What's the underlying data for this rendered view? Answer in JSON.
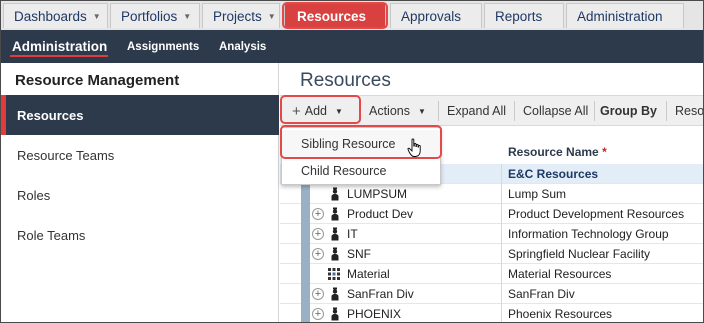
{
  "top_tabs": [
    {
      "label": "Dashboards",
      "has_caret": true
    },
    {
      "label": "Portfolios",
      "has_caret": true
    },
    {
      "label": "Projects",
      "has_caret": true
    },
    {
      "label": "Resources",
      "has_caret": false,
      "active": true
    },
    {
      "label": "Approvals",
      "has_caret": false
    },
    {
      "label": "Reports",
      "has_caret": false
    },
    {
      "label": "Administration",
      "has_caret": false
    }
  ],
  "sub_nav": {
    "administration": "Administration",
    "assignments": "Assignments",
    "analysis": "Analysis"
  },
  "sidebar": {
    "title": "Resource Management",
    "items": [
      {
        "label": "Resources",
        "active": true
      },
      {
        "label": "Resource Teams"
      },
      {
        "label": "Roles"
      },
      {
        "label": "Role Teams"
      }
    ]
  },
  "main": {
    "title": "Resources",
    "toolbar": {
      "add": "Add",
      "actions": "Actions",
      "expand_all": "Expand All",
      "collapse_all": "Collapse All",
      "group_by": "Group By",
      "overflow": "Resou"
    },
    "dropdown": {
      "sibling": "Sibling Resource",
      "child": "Child Resource"
    },
    "column_header": "Resource Name",
    "required_mark": "*",
    "rows": [
      {
        "code": "",
        "name": "E&C Resources",
        "icon": "",
        "expandable": false
      },
      {
        "code": "LUMPSUM",
        "name": "Lump Sum",
        "icon": "person-icon",
        "expandable": false
      },
      {
        "code": "Product Dev",
        "name": "Product Development Resources",
        "icon": "person-icon",
        "expandable": true
      },
      {
        "code": "IT",
        "name": "Information Technology Group",
        "icon": "person-icon",
        "expandable": true
      },
      {
        "code": "SNF",
        "name": "Springfield Nuclear Facility",
        "icon": "person-icon",
        "expandable": true
      },
      {
        "code": "Material",
        "name": "Material Resources",
        "icon": "material-icon",
        "expandable": false
      },
      {
        "code": "SanFran Div",
        "name": "SanFran Div",
        "icon": "person-icon",
        "expandable": true
      },
      {
        "code": "PHOENIX",
        "name": "Phoenix Resources",
        "icon": "person-icon",
        "expandable": true
      }
    ]
  },
  "colors": {
    "accent_red": "#e33b3b",
    "nav_dark": "#2c3a4c",
    "highlight": "#e24a4a"
  }
}
